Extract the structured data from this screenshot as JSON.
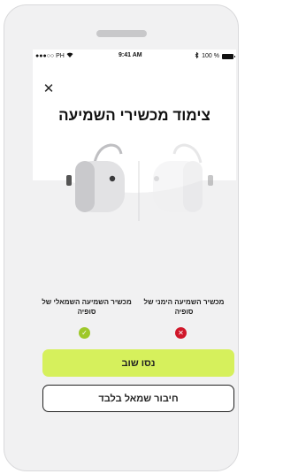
{
  "status_bar": {
    "carrier": "●●●○○ PH",
    "wifi": "wifi-icon",
    "time": "9:41 AM",
    "bluetooth": "bluetooth-icon",
    "battery_percent": "100 %"
  },
  "close": {
    "icon": "close-icon",
    "glyph": "✕"
  },
  "title": "צימוד מכשירי השמיעה",
  "illustration": {
    "left_aid": "hearing-aid-left",
    "right_aid": "hearing-aid-right"
  },
  "pairing": {
    "left": {
      "label": "מכשיר השמיעה השמאלי של סופיה",
      "status": "success",
      "glyph": "✓",
      "color": "#9ec82a"
    },
    "right": {
      "label": "מכשיר השמיעה הימני של סופיה",
      "status": "failed",
      "glyph": "✕",
      "color": "#d0172a"
    }
  },
  "buttons": {
    "retry_label": "נסו שוב",
    "left_only_label": "חיבור שמאל בלבד",
    "accent": "#d6f05c"
  }
}
